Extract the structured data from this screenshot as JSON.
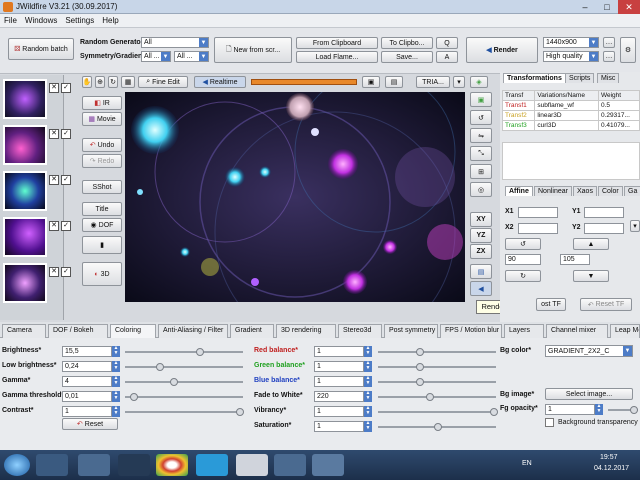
{
  "window": {
    "title": "JWildfire V3.21 (30.09.2017)"
  },
  "menu": [
    "File",
    "Windows",
    "Settings",
    "Help"
  ],
  "toolbar": {
    "random_batch": "Random batch",
    "random_generator_label": "Random Generator",
    "random_generator_value": "All",
    "symmetry_label": "Symmetry/Gradient",
    "symmetry_value1": "All ...",
    "symmetry_value2": "All ...",
    "new_from_scratch": "New from scr...",
    "from_clipboard": "From Clipboard",
    "load_flame": "Load Flame...",
    "to_clipboard": "To Clipbo...",
    "save": "Save...",
    "q": "Q",
    "a": "A",
    "render": "Render",
    "resolution": "1440x900",
    "quality": "High quality"
  },
  "preview_toolbar": {
    "fine_edit": "Fine Edit",
    "realtime": "Realtime",
    "tria": "TRIA..."
  },
  "side_buttons": {
    "ir": "IR",
    "movie": "Movie",
    "undo": "Undo",
    "redo": "Redo",
    "sshot": "SShot",
    "title": "Title",
    "dof": "DOF",
    "three_d": "3D"
  },
  "right_tools": {
    "xy": "XY",
    "yz": "YZ",
    "zx": "ZX"
  },
  "tooltip": "Render image",
  "right_panel": {
    "tabs": [
      "Transformations",
      "Scripts",
      "Misc"
    ],
    "table_headers": [
      "Transf",
      "Variations/Name",
      "Weight"
    ],
    "rows": [
      {
        "transf": "Transf1",
        "name": "subflame_wf",
        "weight": "0.5",
        "color": "#c02020"
      },
      {
        "transf": "Transf2",
        "name": "linear3D",
        "weight": "0.29317...",
        "color": "#c8a020"
      },
      {
        "transf": "Transf3",
        "name": "curl3D",
        "weight": "0.41079...",
        "color": "#20a020"
      }
    ],
    "subtabs": [
      "Affine",
      "Nonlinear",
      "Xaos",
      "Color",
      "Ga"
    ],
    "x1": "X1",
    "y1": "Y1",
    "x2": "X2",
    "y2": "Y2",
    "val_90": "90",
    "val_105": "105",
    "reset_tf": "Reset TF",
    "ost_tf": "ost TF"
  },
  "bottom_tabs": [
    "Camera",
    "DOF / Bokeh",
    "Coloring",
    "Anti-Aliasing / Filter",
    "Gradient",
    "3D rendering",
    "Stereo3d",
    "Post symmetry",
    "FPS / Motion blur",
    "Layers",
    "Channel mixer",
    "Leap Mo"
  ],
  "coloring": {
    "brightness_label": "Brightness*",
    "brightness": "15,5",
    "low_brightness_label": "Low brightness*",
    "low_brightness": "0,24",
    "gamma_label": "Gamma*",
    "gamma": "4",
    "gamma_threshold_label": "Gamma threshold*",
    "gamma_threshold": "0,01",
    "contrast_label": "Contrast*",
    "contrast": "1",
    "reset": "Reset",
    "red_balance_label": "Red balance*",
    "red_balance": "1",
    "green_balance_label": "Green balance*",
    "green_balance": "1",
    "blue_balance_label": "Blue balance*",
    "blue_balance": "1",
    "fade_to_white_label": "Fade to White*",
    "fade_to_white": "220",
    "vibrancy_label": "Vibrancy*",
    "vibrancy": "1",
    "saturation_label": "Saturation*",
    "saturation": "1",
    "bg_color_label": "Bg color*",
    "bg_color": "GRADIENT_2X2_C",
    "bg_image_label": "Bg image*",
    "select_image": "Select image...",
    "fg_opacity_label": "Fg opacity*",
    "fg_opacity": "1",
    "background_transparency": "Background transparency"
  },
  "taskbar": {
    "lang": "EN",
    "time": "19:57",
    "date": "04.12.2017"
  },
  "colors": {
    "accent": "#4d7cc7",
    "realtime_bar": "#e8882a"
  }
}
